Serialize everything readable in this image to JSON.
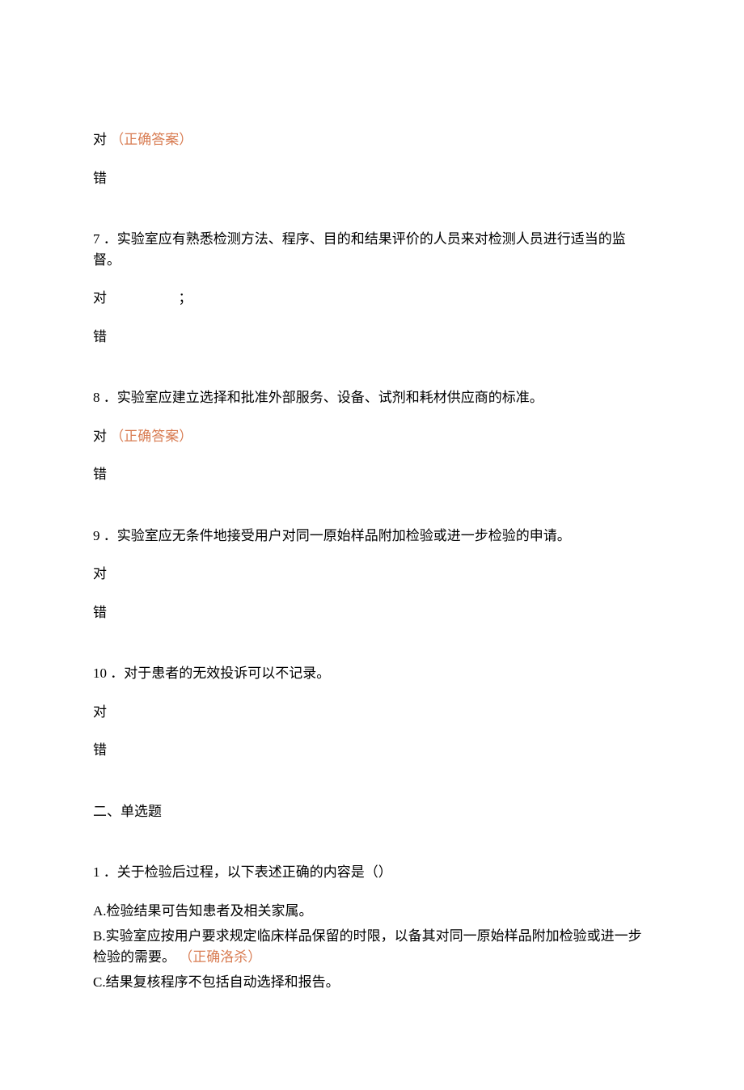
{
  "q_prev": {
    "opt_true": "对",
    "correct_label": "（正确答案）",
    "opt_false": "错"
  },
  "q7": {
    "number": "7",
    "text": "．实验室应有熟悉检测方法、程序、目的和结果评价的人员来对检测人员进行适当的监督。",
    "opt_true": "对",
    "extra": "；",
    "opt_false": "错"
  },
  "q8": {
    "number": "8",
    "text": "．实验室应建立选择和批准外部服务、设备、试剂和耗材供应商的标准。",
    "opt_true": "对",
    "correct_label": "（正确答案）",
    "opt_false": "错"
  },
  "q9": {
    "number": "9",
    "text": "．实验室应无条件地接受用户对同一原始样品附加检验或进一步检验的申请。",
    "opt_true": "对",
    "opt_false": "错"
  },
  "q10": {
    "number": "10",
    "text": "．对于患者的无效投诉可以不记录。",
    "opt_true": "对",
    "opt_false": "错"
  },
  "section2": {
    "title": "二、单选题",
    "q1": {
      "number": "1",
      "text": "．关于检验后过程，以下表述正确的内容是（）",
      "opt_a": "A.检验结果可告知患者及相关家属。",
      "opt_b": "B.实验室应按用户要求规定临床样品保留的时限，以备其对同一原始样品附加检验或进一步检验的需要。",
      "opt_b_correct": "（正确洛杀）",
      "opt_c": "C.结果复核程序不包括自动选择和报告。"
    }
  }
}
